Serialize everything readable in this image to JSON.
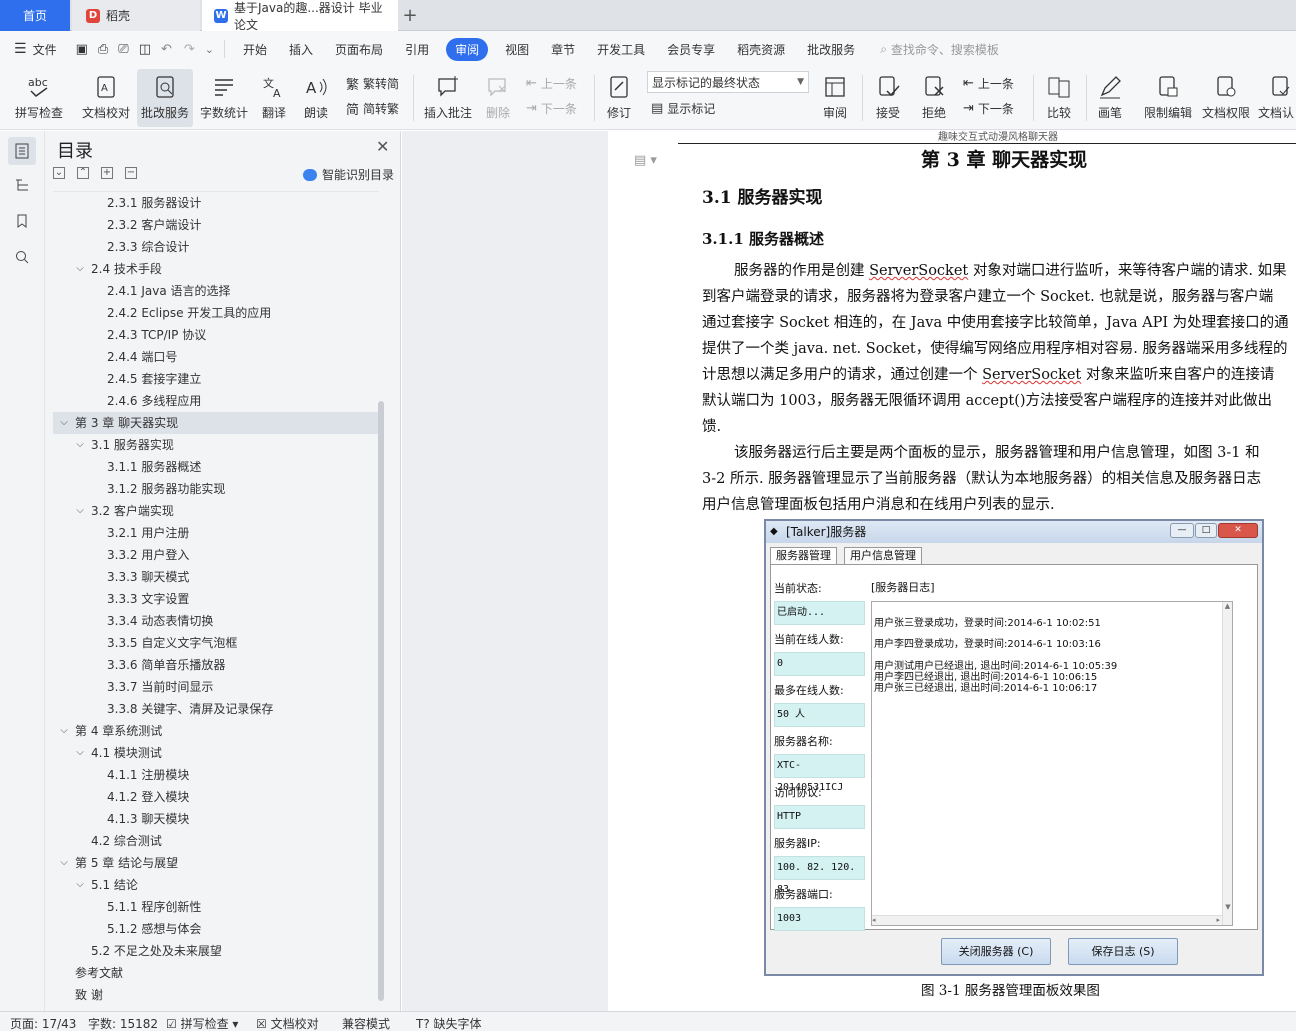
{
  "tabs": [
    {
      "label": "首页",
      "active": true
    },
    {
      "label": "稻壳"
    },
    {
      "label": "基于Java的趣...器设计 毕业论文"
    }
  ],
  "new_tab": "+",
  "menu": {
    "file": "文件",
    "items": [
      "开始",
      "插入",
      "页面布局",
      "引用",
      "审阅",
      "视图",
      "章节",
      "开发工具",
      "会员专享",
      "稻壳资源",
      "批改服务"
    ],
    "active": "审阅",
    "search_placeholder": "查找命令、搜索模板"
  },
  "ribbon": {
    "spell": "拼写检查",
    "doc_check": "文档校对",
    "revise_service": "批改服务",
    "word_count": "字数统计",
    "translate": "翻译",
    "read_aloud": "朗读",
    "trad": "繁转简",
    "simp": "简转繁",
    "insert_comment": "插入批注",
    "delete": "删除",
    "prev": "上一条",
    "next": "下一条",
    "track": "修订",
    "markup_state": "显示标记的最终状态",
    "show_markup": "显示标记",
    "review": "审阅",
    "accept": "接受",
    "reject": "拒绝",
    "prev2": "上一条",
    "next2": "下一条",
    "compare": "比较",
    "pen": "画笔",
    "restrict": "限制编辑",
    "rights": "文档权限",
    "cert": "文档认"
  },
  "toc": {
    "title": "目录",
    "smart": "智能识别目录",
    "items": [
      {
        "text": "2.3.1  服务器设计",
        "level": 3
      },
      {
        "text": "2.3.2  客户端设计",
        "level": 3
      },
      {
        "text": "2.3.3  综合设计",
        "level": 3
      },
      {
        "text": "2.4  技术手段",
        "level": 2,
        "open": true
      },
      {
        "text": "2.4.1 Java 语言的选择",
        "level": 3
      },
      {
        "text": "2.4.2 Eclipse 开发工具的应用",
        "level": 3
      },
      {
        "text": "2.4.3 TCP/IP 协议",
        "level": 3
      },
      {
        "text": "2.4.4  端口号",
        "level": 3
      },
      {
        "text": "2.4.5  套接字建立",
        "level": 3
      },
      {
        "text": "2.4.6  多线程应用",
        "level": 3
      },
      {
        "text": "第 3 章  聊天器实现",
        "level": 1,
        "open": true,
        "selected": true
      },
      {
        "text": "3.1  服务器实现",
        "level": 2,
        "open": true
      },
      {
        "text": "3.1.1  服务器概述",
        "level": 3
      },
      {
        "text": "3.1.2  服务器功能实现",
        "level": 3
      },
      {
        "text": "3.2  客户端实现",
        "level": 2,
        "open": true
      },
      {
        "text": "3.2.1  用户注册",
        "level": 3
      },
      {
        "text": "3.3.2  用户登入",
        "level": 3
      },
      {
        "text": "3.3.3  聊天模式",
        "level": 3
      },
      {
        "text": "3.3.3  文字设置",
        "level": 3
      },
      {
        "text": "3.3.4  动态表情切换",
        "level": 3
      },
      {
        "text": "3.3.5  自定义文字气泡框",
        "level": 3
      },
      {
        "text": "3.3.6  简单音乐播放器",
        "level": 3
      },
      {
        "text": "3.3.7  当前时间显示",
        "level": 3
      },
      {
        "text": "3.3.8  关键字、清屏及记录保存",
        "level": 3
      },
      {
        "text": "第 4 章系统测试",
        "level": 1,
        "open": true
      },
      {
        "text": "4.1  模块测试",
        "level": 2,
        "open": true
      },
      {
        "text": "4.1.1  注册模块",
        "level": 3
      },
      {
        "text": "4.1.2  登入模块",
        "level": 3
      },
      {
        "text": "4.1.3  聊天模块",
        "level": 3
      },
      {
        "text": "4.2  综合测试",
        "level": 2
      },
      {
        "text": "第 5 章  结论与展望",
        "level": 1,
        "open": true
      },
      {
        "text": "5.1  结论",
        "level": 2,
        "open": true
      },
      {
        "text": "5.1.1  程序创新性",
        "level": 3
      },
      {
        "text": "5.1.2  感想与体会",
        "level": 3
      },
      {
        "text": "5.2  不足之处及未来展望",
        "level": 2
      },
      {
        "text": "参考文献",
        "level": 1
      },
      {
        "text": "致    谢",
        "level": 1
      }
    ]
  },
  "doc": {
    "header": "趣味交互式动漫风格聊天器",
    "chapter": "第 3 章  聊天器实现",
    "h2": "3.1  服务器实现",
    "h3": "3.1.1  服务器概述",
    "p1": {
      "l1a": "服务器的作用是创建 ",
      "l1b": "ServerSocket",
      "l1c": " 对象对端口进行监听，来等待客户端的请求. 如果",
      "l2": "到客户端登录的请求，服务器将为登录客户建立一个 Socket. 也就是说，服务器与客户端",
      "l3": "通过套接字 Socket 相连的，在 Java 中使用套接字比较简单，Java API 为处理套接口的通",
      "l4": "提供了一个类 java. net. Socket，使得编写网络应用程序相对容易. 服务器端采用多线程的",
      "l5a": "计思想以满足多用户的请求，通过创建一个 ",
      "l5b": "ServerSocket",
      "l5c": " 对象来监听来自客户的连接请",
      "l6": "默认端口为 1003，服务器无限循环调用 accept()方法接受客户端程序的连接并对此做出",
      "l7": "馈."
    },
    "p2": {
      "l1": "该服务器运行后主要是两个面板的显示，服务器管理和用户信息管理，如图 3-1 和",
      "l2": "3-2 所示. 服务器管理显示了当前服务器（默认为本地服务器）的相关信息及服务器日志",
      "l3": "用户信息管理面板包括用户消息和在线用户列表的显示."
    },
    "figure": {
      "title": "[Talker]服务器",
      "tab1": "服务器管理",
      "tab2": "用户信息管理",
      "labels": [
        "当前状态:",
        "当前在线人数:",
        "最多在线人数:",
        "服务器名称:",
        "访问协议:",
        "服务器IP:",
        "服务器端口:"
      ],
      "values": [
        "已启动...",
        "0",
        "50 人",
        "XTC-20140531ICJ",
        "HTTP",
        "100. 82. 120. 83",
        "1003"
      ],
      "log_label": "[服务器日志]",
      "log": [
        "用户张三登录成功，登录时间:2014-6-1  10:02:51",
        "用户李四登录成功，登录时间:2014-6-1  10:03:16",
        "用户测试用户已经退出, 退出时间:2014-6-1  10:05:39",
        "用户李四已经退出, 退出时间:2014-6-1  10:06:15",
        "用户张三已经退出, 退出时间:2014-6-1  10:06:17"
      ],
      "btn_close": "关闭服务器 (C)",
      "btn_save": "保存日志 (S)",
      "caption": "图 3-1  服务器管理面板效果图"
    }
  },
  "status": {
    "page": "页面: 17/43",
    "words": "字数: 15182",
    "spell": "拼写检查",
    "check": "文档校对",
    "compat": "兼容模式",
    "font": "缺失字体"
  },
  "colors": {
    "accent": "#2f6fed",
    "fig_field": "#d4f2f2"
  }
}
